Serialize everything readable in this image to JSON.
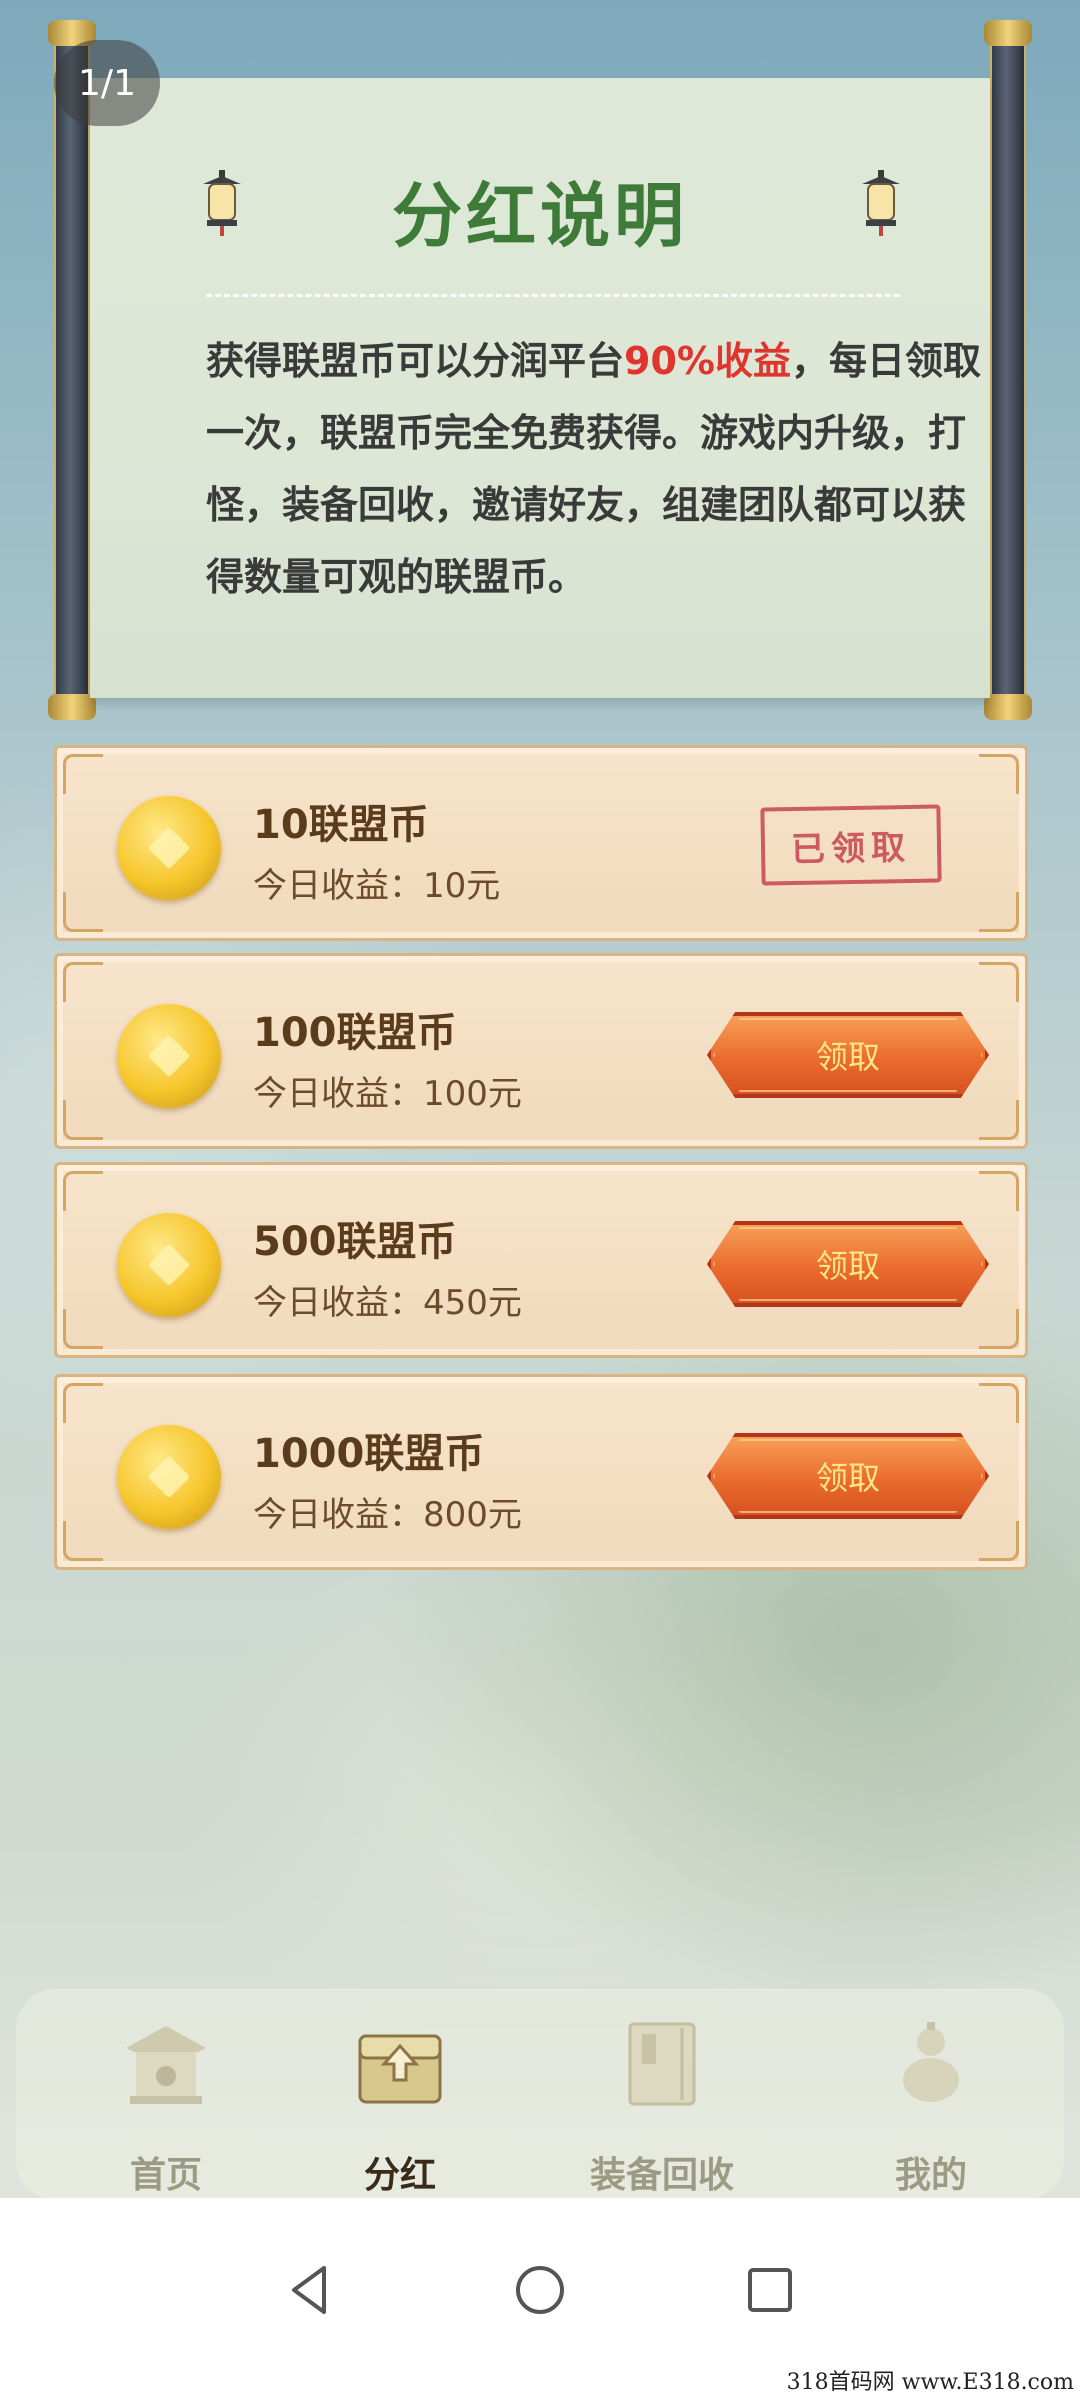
{
  "page_counter": "1/1",
  "scroll": {
    "title": "分红说明",
    "desc_before": "获得联盟币可以分润平台",
    "desc_highlight": "90%收益",
    "desc_after": "，每日领取一次，联盟币完全免费获得。游戏内升级，打怪，装备回收，邀请好友，组建团队都可以获得数量可观的联盟币。"
  },
  "rewards": [
    {
      "title": "10联盟币",
      "sub": "今日收益：10元",
      "status": "已领取"
    },
    {
      "title": "100联盟币",
      "sub": "今日收益：100元",
      "button": "领取"
    },
    {
      "title": "500联盟币",
      "sub": "今日收益：450元",
      "button": "领取"
    },
    {
      "title": "1000联盟币",
      "sub": "今日收益：800元",
      "button": "领取"
    }
  ],
  "tabs": [
    {
      "label": "首页",
      "icon": "temple-icon",
      "active": false
    },
    {
      "label": "分红",
      "icon": "treasure-chest-icon",
      "active": true
    },
    {
      "label": "装备回收",
      "icon": "book-icon",
      "active": false
    },
    {
      "label": "我的",
      "icon": "gourd-icon",
      "active": false
    }
  ],
  "watermark": "318首码网 www.E318.com",
  "colors": {
    "title_green": "#3e7a38",
    "highlight_red": "#e0352e",
    "button_orange": "#ea6b2e",
    "stamp_red": "#c5454f"
  }
}
